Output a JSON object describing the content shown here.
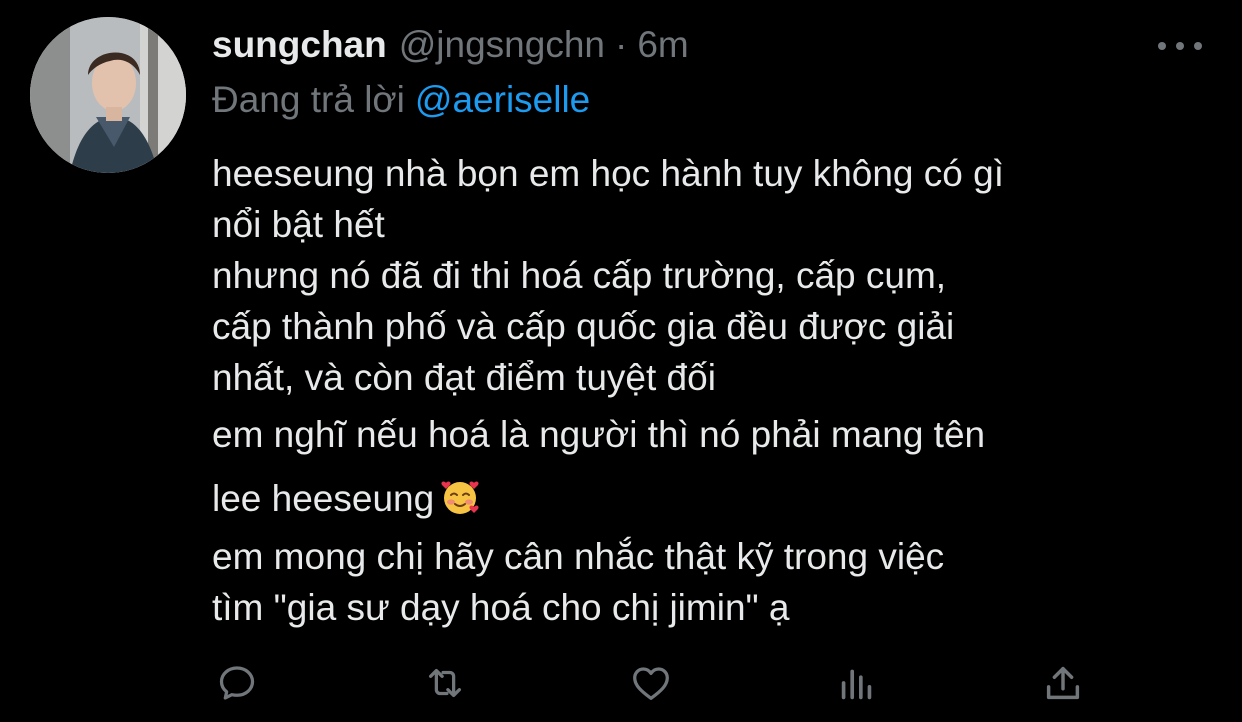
{
  "tweet": {
    "display_name": "sungchan",
    "handle": "@jngsngchn",
    "separator": "·",
    "time": "6m",
    "reply_prefix": "Đang trả lời",
    "reply_mention": "@aeriselle",
    "lines": [
      "heeseung nhà bọn em học hành tuy không có gì",
      "nổi bật hết",
      "nhưng nó đã đi thi hoá cấp trường, cấp cụm,",
      "cấp thành phố và cấp quốc gia đều được giải",
      "nhất, và còn đạt điểm tuyệt đối",
      "em nghĩ nếu hoá là người thì nó phải mang tên",
      "lee heeseung",
      "em mong chị hãy cân nhắc thật kỹ trong việc",
      "tìm \"gia sư dạy hoá cho chị jimin\" ạ"
    ],
    "emoji": "smiling-face-with-hearts"
  },
  "actions": {
    "reply_icon": "reply-icon",
    "retweet_icon": "retweet-icon",
    "like_icon": "heart-icon",
    "analytics_icon": "analytics-icon",
    "share_icon": "share-icon"
  },
  "colors": {
    "background": "#000000",
    "text": "#e7e9ea",
    "secondary": "#71767b",
    "accent": "#1d9bf0"
  }
}
